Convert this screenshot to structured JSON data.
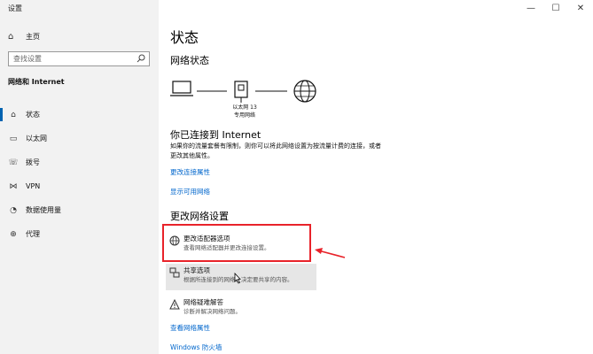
{
  "window": {
    "title": "设置",
    "minimize": "—",
    "maximize": "☐",
    "close": "✕"
  },
  "sidebar": {
    "home_label": "主页",
    "search_placeholder": "查找设置",
    "section": "网络和 Internet",
    "items": [
      {
        "label": "状态",
        "icon": "home-icon",
        "active": true
      },
      {
        "label": "以太网",
        "icon": "ethernet-icon"
      },
      {
        "label": "拨号",
        "icon": "dialup-icon"
      },
      {
        "label": "VPN",
        "icon": "vpn-icon"
      },
      {
        "label": "数据使用量",
        "icon": "data-usage-icon"
      },
      {
        "label": "代理",
        "icon": "globe-icon"
      }
    ]
  },
  "main": {
    "title": "状态",
    "network_status_heading": "网络状态",
    "network_name": "以太网 13",
    "network_type": "专用网络",
    "connected_heading": "你已连接到 Internet",
    "connected_text": "如果你的流量套餐有限制，则你可以将此网络设置为按流量计费的连接，或者更改其他属性。",
    "links": {
      "change_props": "更改连接属性",
      "show_networks": "显示可用网络"
    },
    "change_settings_heading": "更改网络设置",
    "options": [
      {
        "title": "更改适配器选项",
        "desc": "查看网络适配器并更改连接设置。",
        "icon": "adapter-icon"
      },
      {
        "title": "共享选项",
        "desc": "根据所连接到的网络，决定要共享的内容。",
        "icon": "sharing-icon"
      },
      {
        "title": "网络疑难解答",
        "desc": "诊断并解决网络问题。",
        "icon": "warning-icon"
      }
    ],
    "bottom_links": {
      "view_props": "查看网络属性",
      "firewall": "Windows 防火墙"
    }
  },
  "colors": {
    "accent": "#0063b1",
    "link": "#0066cc",
    "highlight": "#e8232a"
  }
}
